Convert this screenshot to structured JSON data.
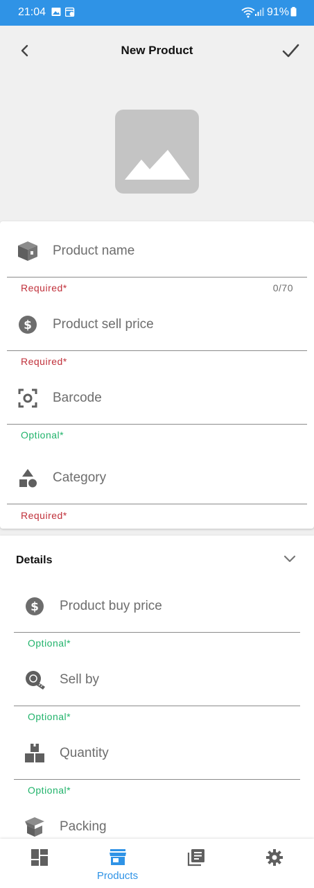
{
  "status_bar": {
    "time": "21:04",
    "battery": "91%",
    "icons": [
      "gallery-icon",
      "calendar-icon",
      "wifi-icon",
      "signal-icon",
      "battery-icon"
    ]
  },
  "app_bar": {
    "title": "New Product",
    "back_icon": "back-arrow-icon",
    "confirm_icon": "check-icon"
  },
  "product_image": {
    "icon": "image-placeholder-icon"
  },
  "main_fields": [
    {
      "icon": "box-icon",
      "label": "Product name",
      "helper": "Required*",
      "helper_type": "required",
      "counter": "0/70"
    },
    {
      "icon": "dollar-icon",
      "label": "Product sell price",
      "helper": "Required*",
      "helper_type": "required"
    },
    {
      "icon": "barcode-scan-icon",
      "label": "Barcode",
      "helper": "Optional*",
      "helper_type": "optional"
    },
    {
      "icon": "category-shapes-icon",
      "label": "Category",
      "helper": "Required*",
      "helper_type": "required"
    }
  ],
  "details": {
    "title": "Details",
    "expand_icon": "chevron-down-icon",
    "fields": [
      {
        "icon": "dollar-icon",
        "label": "Product buy price",
        "helper": "Optional*",
        "helper_type": "optional"
      },
      {
        "icon": "measuring-tape-icon",
        "label": "Sell by",
        "helper": "Optional*",
        "helper_type": "optional"
      },
      {
        "icon": "boxes-icon",
        "label": "Quantity",
        "helper": "Optional*",
        "helper_type": "optional"
      },
      {
        "icon": "open-box-icon",
        "label": "Packing"
      }
    ]
  },
  "bottom_nav": {
    "items": [
      {
        "icon": "dashboard-icon",
        "label": ""
      },
      {
        "icon": "store-icon",
        "label": "Products",
        "active": true
      },
      {
        "icon": "library-icon",
        "label": ""
      },
      {
        "icon": "settings-gear-icon",
        "label": ""
      }
    ]
  },
  "colors": {
    "primary": "#2f93e6",
    "required": "#c0303a",
    "optional": "#21b36b",
    "icon_gray": "#6d6d6d",
    "background": "#f0f0f0"
  }
}
